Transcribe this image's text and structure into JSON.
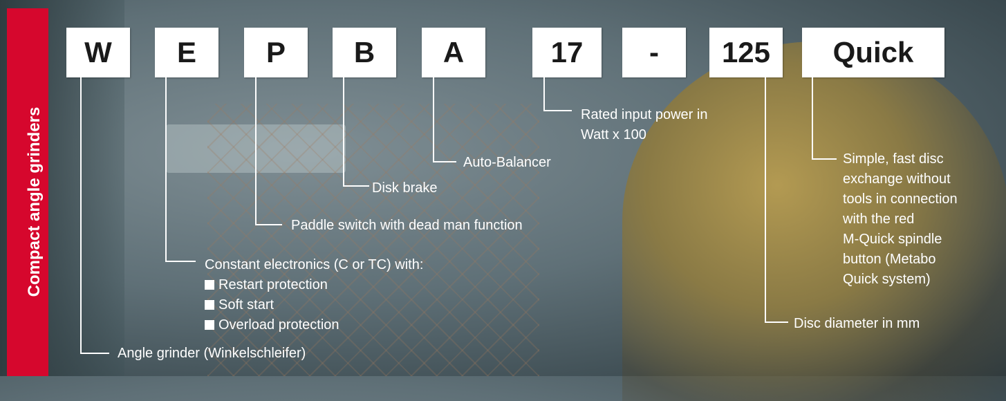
{
  "sidebar": {
    "title": "Compact angle grinders"
  },
  "code_letters": [
    "W",
    "E",
    "P",
    "B",
    "A",
    "17",
    "-",
    "125",
    "Quick"
  ],
  "labels": {
    "angle_grinder": "Angle grinder (Winkelschleifer)",
    "constant_electronics": "Constant electronics (C or TC) with:",
    "electronics_features": [
      "Restart protection",
      "Soft start",
      "Overload protection"
    ],
    "paddle_switch": "Paddle switch with dead man function",
    "disk_brake": "Disk brake",
    "auto_balancer": "Auto-Balancer",
    "rated_power_line1": "Rated input power in",
    "rated_power_line2": "Watt x 100",
    "disc_diameter": "Disc diameter in mm",
    "quick_lines": [
      "Simple, fast disc",
      "exchange without",
      "tools in connection",
      "with the red",
      "M-Quick spindle",
      "button (Metabo",
      "Quick system)"
    ]
  },
  "colors": {
    "sidebar": "#d6072d",
    "box": "#ffffff",
    "text": "#ffffff"
  }
}
